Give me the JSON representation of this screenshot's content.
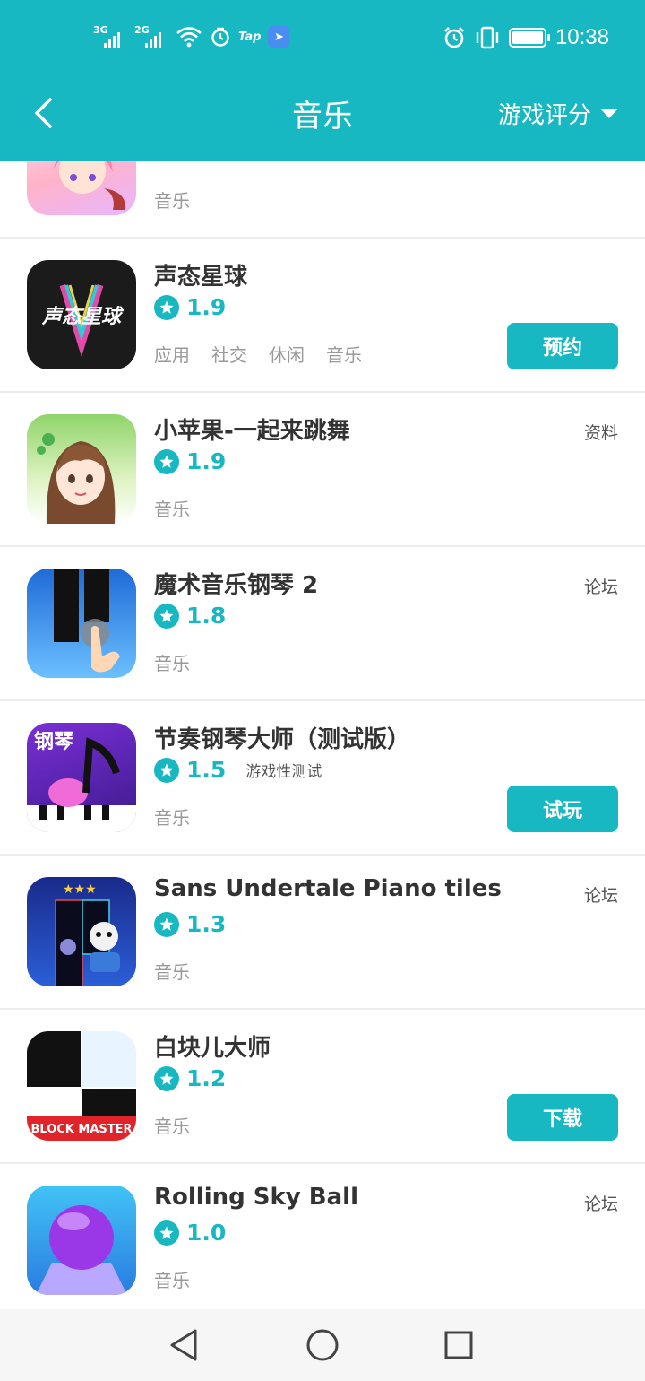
{
  "status_bar": {
    "sim1": "3G",
    "sim2": "2G",
    "tap": "Tap",
    "time": "10:38"
  },
  "header": {
    "title": "音乐",
    "sort_label": "游戏评分"
  },
  "items": [
    {
      "name": "",
      "rating": "",
      "tags": [
        "音乐"
      ],
      "icon": "anime-girl-icon"
    },
    {
      "name": "声态星球",
      "rating": "1.9",
      "tags": [
        "应用",
        "社交",
        "休闲",
        "音乐"
      ],
      "button": "预约",
      "icon": "shengtai-xingqiu-icon",
      "icon_text": "声态星球"
    },
    {
      "name": "小苹果-一起来跳舞",
      "rating": "1.9",
      "tags": [
        "音乐"
      ],
      "link": "资料",
      "icon": "dancer-girl-icon"
    },
    {
      "name": "魔术音乐钢琴 2",
      "rating": "1.8",
      "tags": [
        "音乐"
      ],
      "link": "论坛",
      "icon": "piano-tiles-icon"
    },
    {
      "name": "节奏钢琴大师（测试版）",
      "rating": "1.5",
      "note": "游戏性测试",
      "tags": [
        "音乐"
      ],
      "button": "试玩",
      "icon": "music-note-piano-icon",
      "icon_text": "钢琴"
    },
    {
      "name": "Sans Undertale Piano tiles",
      "rating": "1.3",
      "tags": [
        "音乐"
      ],
      "link": "论坛",
      "icon": "skeleton-piano-icon"
    },
    {
      "name": "白块儿大师",
      "rating": "1.2",
      "tags": [
        "音乐"
      ],
      "button": "下载",
      "icon": "block-master-icon",
      "icon_text": "BLOCK MASTER"
    },
    {
      "name": "Rolling Sky Ball",
      "rating": "1.0",
      "tags": [
        "音乐"
      ],
      "link": "论坛",
      "icon": "purple-ball-icon"
    }
  ],
  "colors": {
    "accent": "#18b8c2",
    "button_text": "#ffffff",
    "tag_text": "#999999"
  }
}
